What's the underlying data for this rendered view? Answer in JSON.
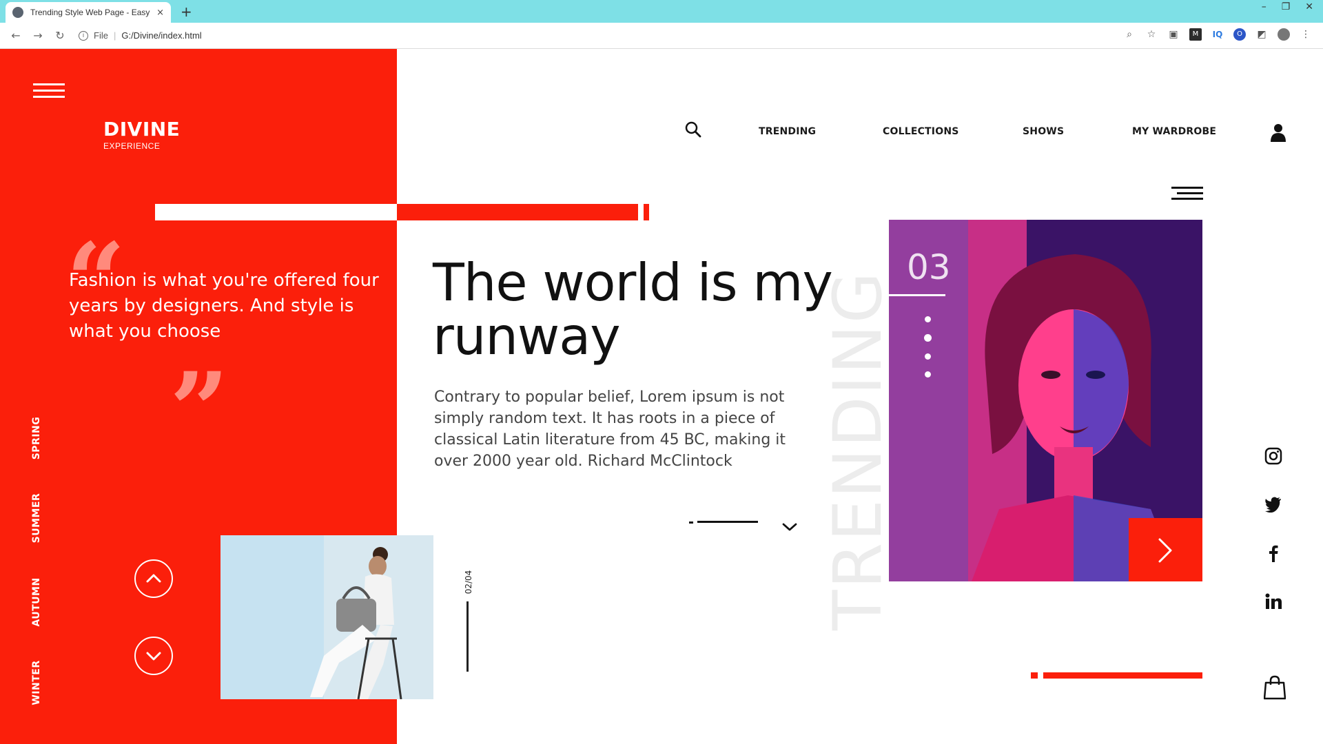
{
  "browser": {
    "tab_title": "Trending Style Web Page - Easy",
    "tab_close": "×",
    "new_tab": "+",
    "url_scheme": "File",
    "url": "G:/Divine/index.html"
  },
  "brand": {
    "name": "DIVINE",
    "sub": "EXPERIENCE"
  },
  "nav": {
    "links": [
      "TRENDING",
      "COLLECTIONS",
      "SHOWS",
      "MY WARDROBE"
    ]
  },
  "quote": {
    "open_mark": "“",
    "close_mark": "”",
    "text": "Fashion is what you're offered four years by designers. And style is what you choose"
  },
  "seasons": [
    "SPRING",
    "SUMMER",
    "AUTUMN",
    "WINTER"
  ],
  "hero": {
    "headline_line1": "The world is my",
    "headline_line2": "runway",
    "body": "Contrary to popular belief, Lorem ipsum is not simply random text. It has roots in a piece of classical Latin literature from 45 BC, making it over 2000 year old. Richard McClintock"
  },
  "slide_counter": "02/04",
  "trending_label": "TRENDING",
  "feature": {
    "number": "03"
  },
  "colors": {
    "brand_red": "#fb1f0b",
    "quote_mark": "#ff8a7c",
    "browser_tabbar": "#7ee0e6"
  },
  "icons": {
    "search": "search-icon",
    "user": "user-icon",
    "instagram": "instagram-icon",
    "twitter": "twitter-icon",
    "facebook": "facebook-icon",
    "linkedin": "linkedin-icon",
    "bag": "shopping-bag-icon"
  }
}
